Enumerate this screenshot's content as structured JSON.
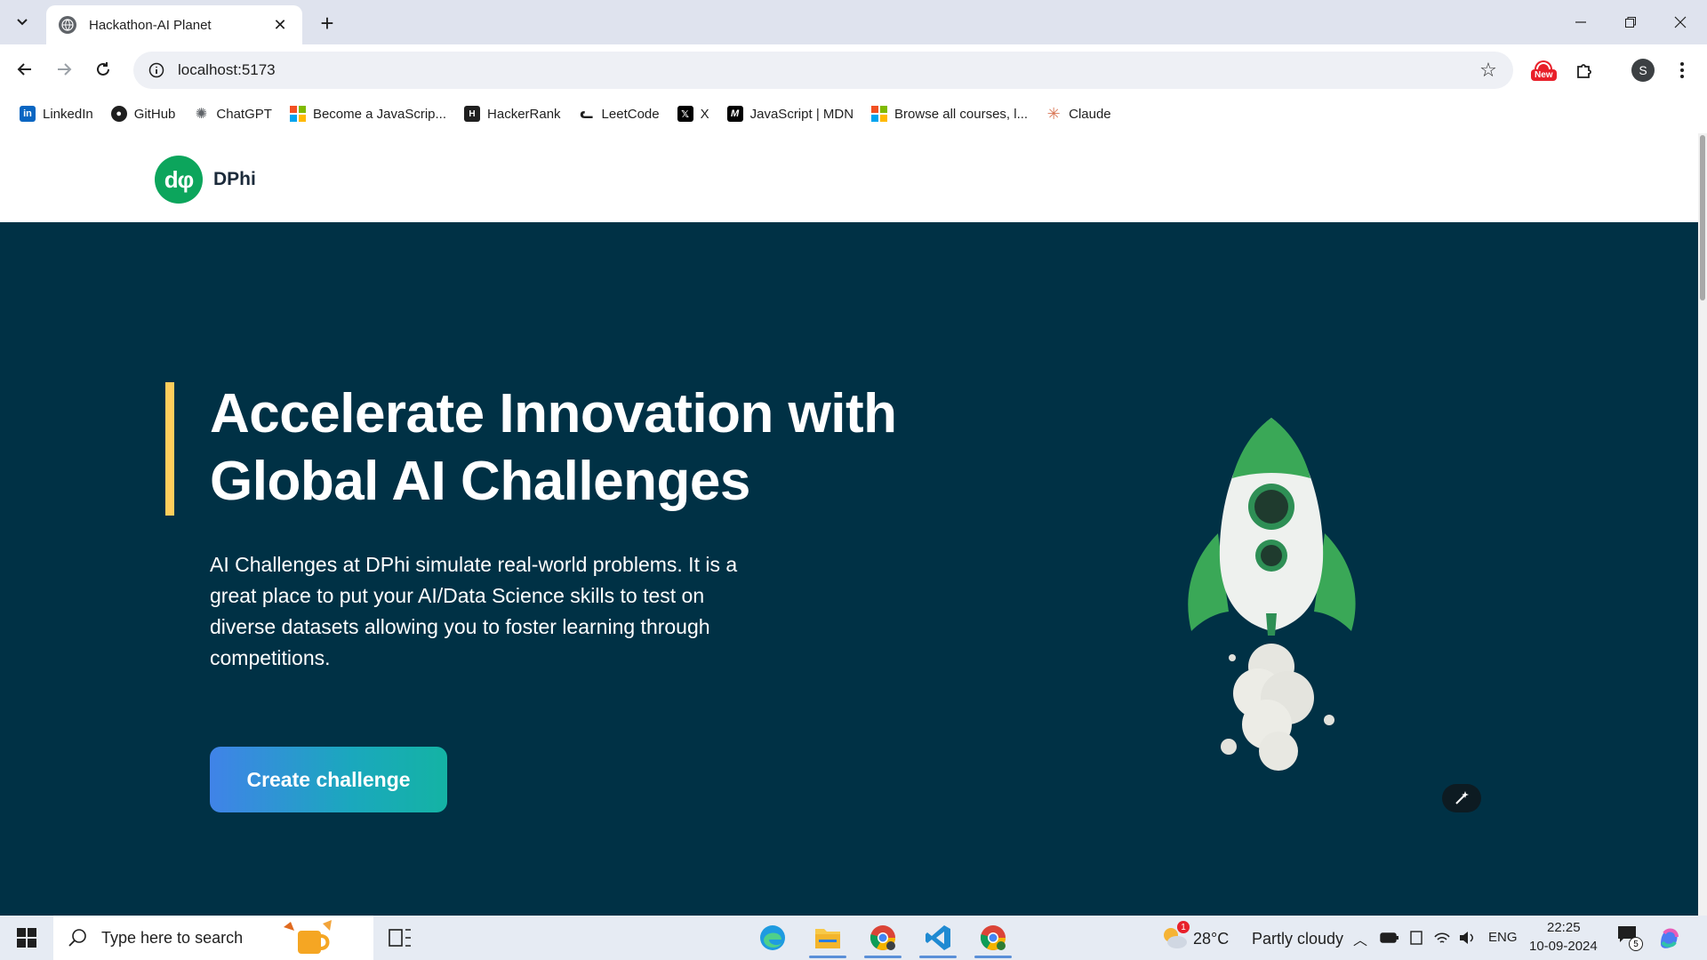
{
  "browser": {
    "tab_title": "Hackathon-AI Planet",
    "url": "localhost:5173",
    "new_badge": "New",
    "profile_initial": "S"
  },
  "bookmarks": [
    {
      "label": "LinkedIn",
      "icon": "linkedin-icon",
      "color": "#0a66c2"
    },
    {
      "label": "GitHub",
      "icon": "github-icon",
      "color": "#1f1f1f"
    },
    {
      "label": "ChatGPT",
      "icon": "chatgpt-icon",
      "color": "#5f6368"
    },
    {
      "label": "Become a JavaScrip...",
      "icon": "microsoft-icon",
      "color": "#f25022"
    },
    {
      "label": "HackerRank",
      "icon": "hackerrank-icon",
      "color": "#1f1f1f"
    },
    {
      "label": "LeetCode",
      "icon": "leetcode-icon",
      "color": "#e7a23c"
    },
    {
      "label": "X",
      "icon": "x-icon",
      "color": "#000000"
    },
    {
      "label": "JavaScript | MDN",
      "icon": "mdn-icon",
      "color": "#000000"
    },
    {
      "label": "Browse all courses, l...",
      "icon": "microsoft-icon",
      "color": "#f25022"
    },
    {
      "label": "Claude",
      "icon": "claude-icon",
      "color": "#d97757"
    }
  ],
  "site": {
    "logo_mark": "dφ",
    "logo_text": "DPhi"
  },
  "hero": {
    "title": "Accelerate Innovation with Global AI Challenges",
    "description": "AI Challenges at DPhi simulate real-world problems. It is a great place to put your AI/Data Science skills to test on diverse datasets allowing you to foster learning through competitions.",
    "cta_label": "Create challenge",
    "colors": {
      "background": "#003145",
      "accent_bar": "#ffce5c",
      "cta_start": "#4083e8",
      "cta_end": "#14b3a4"
    }
  },
  "taskbar": {
    "search_placeholder": "Type here to search",
    "weather_temp": "28°C",
    "weather_desc": "Partly cloudy",
    "weather_badge": "1",
    "language": "ENG",
    "time": "22:25",
    "date": "10-09-2024",
    "notification_count": "5"
  }
}
